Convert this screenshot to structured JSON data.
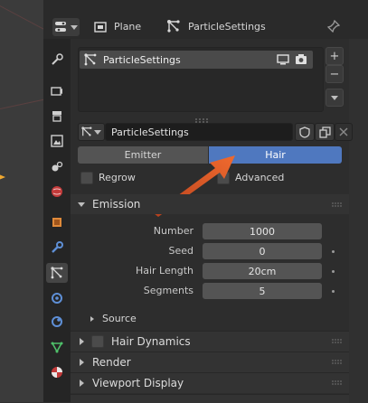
{
  "header": {
    "object_name": "Plane",
    "settings_name": "ParticleSettings"
  },
  "particle_list": {
    "items": [
      {
        "label": "ParticleSettings"
      }
    ],
    "add_label": "+",
    "remove_label": "−"
  },
  "datablock": {
    "name": "ParticleSettings"
  },
  "type_selector": {
    "options": [
      "Emitter",
      "Hair"
    ],
    "selected": "Hair"
  },
  "options": {
    "regrow_label": "Regrow",
    "advanced_label": "Advanced"
  },
  "emission": {
    "title": "Emission",
    "fields": [
      {
        "label": "Number",
        "value": "1000"
      },
      {
        "label": "Seed",
        "value": "0"
      },
      {
        "label": "Hair Length",
        "value": "20cm"
      },
      {
        "label": "Segments",
        "value": "5"
      }
    ],
    "source_label": "Source"
  },
  "sections": {
    "hair_dynamics": "Hair Dynamics",
    "render": "Render",
    "viewport_display": "Viewport Display"
  },
  "colors": {
    "accent_blue": "#4f78bf",
    "arrow": "#e0562a",
    "panel": "#2d2d2d"
  },
  "icons": [
    "editor-type-icon",
    "object-icon",
    "particle-icon",
    "pin-icon",
    "screen-icon",
    "camera-icon",
    "shield-icon",
    "copy-icon",
    "close-icon",
    "chevron-down-icon"
  ]
}
